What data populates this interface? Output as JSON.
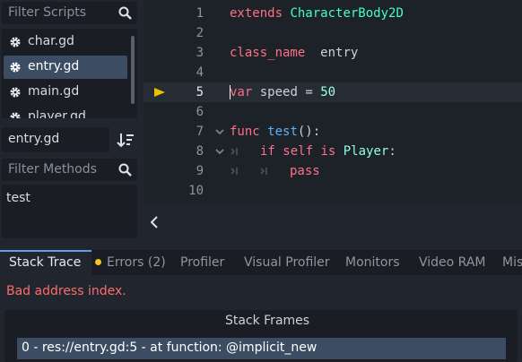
{
  "scripts_panel": {
    "filter_placeholder": "Filter Scripts",
    "items": [
      {
        "label": "char.gd",
        "selected": false
      },
      {
        "label": "entry.gd",
        "selected": true
      },
      {
        "label": "main.gd",
        "selected": false
      },
      {
        "label": "player.gd",
        "selected": false
      }
    ],
    "current_file": "entry.gd",
    "methods_filter_placeholder": "Filter Methods",
    "methods": [
      "test"
    ]
  },
  "editor": {
    "lines": [
      {
        "num": "1",
        "kw": "extends",
        "rest": "CharacterBody2D"
      },
      {
        "num": "2"
      },
      {
        "num": "3",
        "kw": "class_name",
        "rest": "entry"
      },
      {
        "num": "4"
      },
      {
        "num": "5",
        "kw": "var",
        "rest": "speed",
        "op": "=",
        "value": "50",
        "current": true
      },
      {
        "num": "6"
      },
      {
        "num": "7",
        "kw": "func",
        "fn": "test",
        "punct": "():"
      },
      {
        "num": "8",
        "kw": "if",
        "kw2": "self",
        "kw3": "is",
        "cls": "Player",
        "punct": ":"
      },
      {
        "num": "9",
        "kw": "pass"
      },
      {
        "num": "10"
      }
    ]
  },
  "bottom_panel": {
    "tabs": [
      "Stack Trace",
      "Errors (2)",
      "Profiler",
      "Visual Profiler",
      "Monitors",
      "Video RAM",
      "Misc"
    ],
    "active_tab": "Stack Trace",
    "error_message": "Bad address index.",
    "frames_header": "Stack Frames",
    "frames": [
      "0 - res://entry.gd:5 - at function: @implicit_new"
    ]
  },
  "colors": {
    "keyword": "#ff7085",
    "type": "#42ffc2",
    "function": "#57b3ff",
    "number": "#a1ffe0",
    "error": "#ff6b6b",
    "selection": "#3c4d63",
    "warning_dot": "#f5c518",
    "exec_arrow": "#e6c200"
  },
  "icons": [
    "search-icon",
    "gear-icon",
    "sort-icon",
    "execution-arrow-icon",
    "fold-arrow-icon",
    "tab-indicator-icon",
    "collapse-chevron-icon"
  ]
}
